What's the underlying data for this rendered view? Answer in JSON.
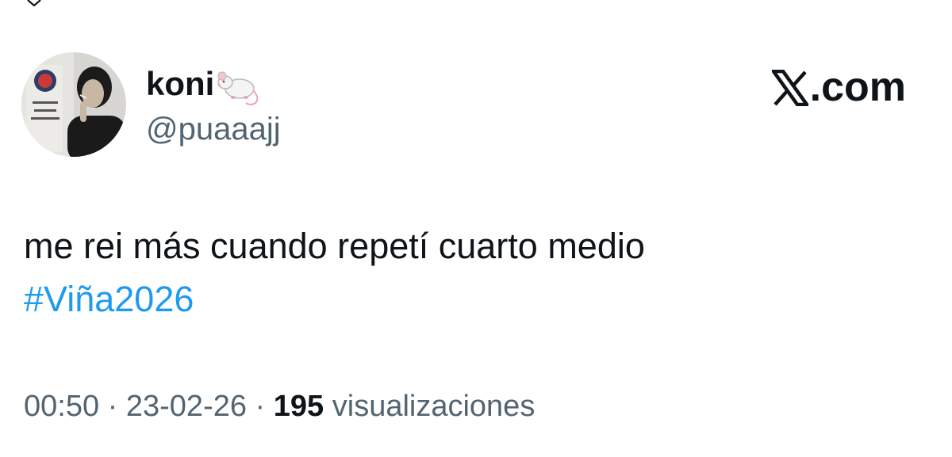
{
  "tweet": {
    "author": {
      "display_name": "koni",
      "name_emoji": "rat-icon",
      "handle": "@puaaajj",
      "avatar": "avatar"
    },
    "brand": {
      "text": ".com",
      "mark": "x-logo-icon"
    },
    "text": "me rei más cuando repetí cuarto medio",
    "hashtag": "#Viña2026",
    "meta": {
      "time": "00:50",
      "separator_1": " · ",
      "date": "23-02-26",
      "separator_2": " · ",
      "views_count": "195",
      "views_label": " visualizaciones"
    }
  },
  "colors": {
    "text_primary": "#0f1419",
    "text_secondary": "#536471",
    "link": "#1d9bf0",
    "background": "#ffffff"
  }
}
